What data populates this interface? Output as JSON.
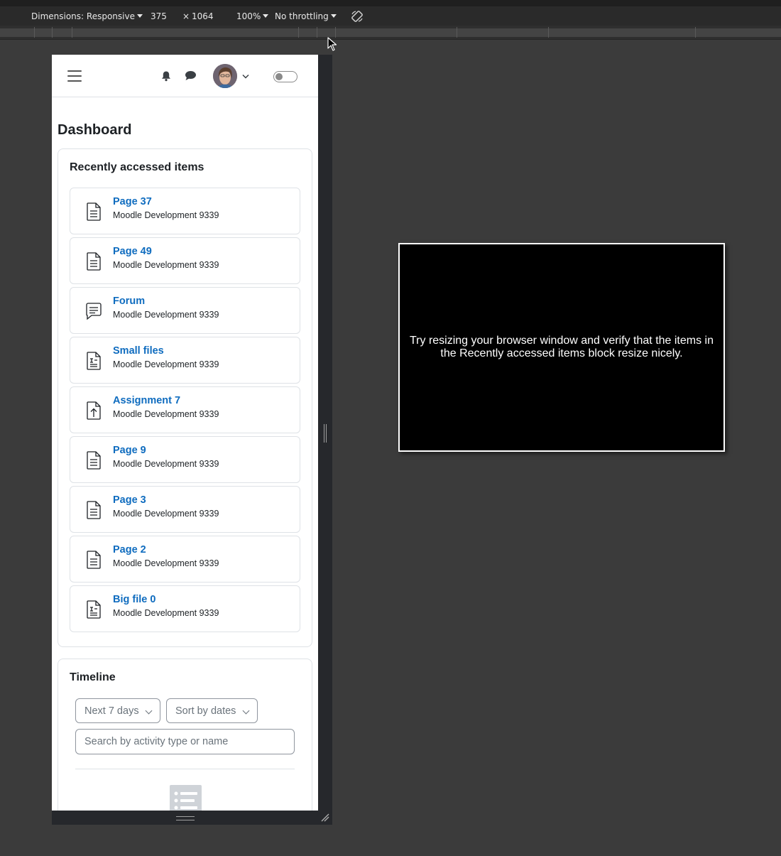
{
  "devtools": {
    "dimensions_label": "Dimensions: Responsive",
    "width": "375",
    "times": "×",
    "height": "1064",
    "zoom": "100%",
    "throttling": "No throttling"
  },
  "navbar": {
    "icons": [
      "menu-icon",
      "bell-icon",
      "chat-bubble-icon",
      "user-avatar",
      "chevron-down-icon",
      "toggle-switch"
    ]
  },
  "dashboard": {
    "title": "Dashboard",
    "recent": {
      "title": "Recently accessed items",
      "items": [
        {
          "name": "Page 37",
          "course": "Moodle Development 9339",
          "icon": "page-icon"
        },
        {
          "name": "Page 49",
          "course": "Moodle Development 9339",
          "icon": "page-icon"
        },
        {
          "name": "Forum",
          "course": "Moodle Development 9339",
          "icon": "forum-icon"
        },
        {
          "name": "Small files",
          "course": "Moodle Development 9339",
          "icon": "file-icon"
        },
        {
          "name": "Assignment 7",
          "course": "Moodle Development 9339",
          "icon": "assignment-icon"
        },
        {
          "name": "Page 9",
          "course": "Moodle Development 9339",
          "icon": "page-icon"
        },
        {
          "name": "Page 3",
          "course": "Moodle Development 9339",
          "icon": "page-icon"
        },
        {
          "name": "Page 2",
          "course": "Moodle Development 9339",
          "icon": "page-icon"
        },
        {
          "name": "Big file 0",
          "course": "Moodle Development 9339",
          "icon": "file-icon"
        }
      ]
    },
    "timeline": {
      "title": "Timeline",
      "filter_label": "Next 7 days",
      "sort_label": "Sort by dates",
      "search_placeholder": "Search by activity type or name"
    }
  },
  "tooltip": {
    "text": "Try resizing your browser window and verify that the items in the Recently accessed items block resize nicely."
  },
  "colors": {
    "link": "#0f6cbf",
    "text": "#1d2125",
    "border": "#dee2e6",
    "devtools_bg": "#3b3b3b"
  }
}
